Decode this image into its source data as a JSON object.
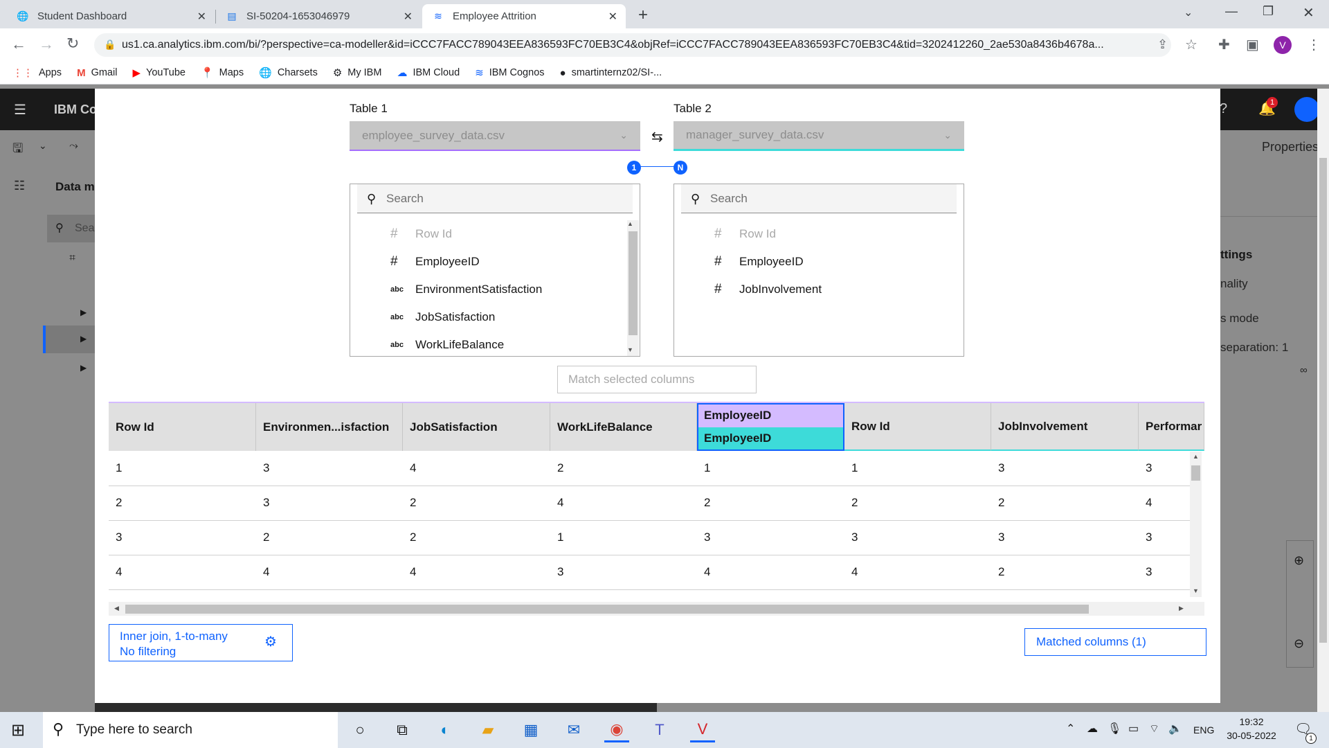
{
  "browser": {
    "tabs": [
      {
        "title": "Student Dashboard"
      },
      {
        "title": "SI-50204-1653046979"
      },
      {
        "title": "Employee Attrition"
      }
    ],
    "url": "us1.ca.analytics.ibm.com/bi/?perspective=ca-modeller&id=iCCC7FACC789043EEA836593FC70EB3C4&objRef=iCCC7FACC789043EEA836593FC70EB3C4&tid=3202412260_2ae530a8436b4678a...",
    "profile_initial": "V",
    "bookmarks": [
      "Apps",
      "Gmail",
      "YouTube",
      "Maps",
      "Charsets",
      "My IBM",
      "IBM Cloud",
      "IBM Cognos",
      "smartinternz02/SI-..."
    ]
  },
  "app": {
    "brand": "IBM Co",
    "notif_count": "1",
    "left_labels": {
      "data_module": "Data m",
      "search": "Sea"
    },
    "right_labels": {
      "properties": "Properties",
      "settings": "ttings",
      "nality": "nality",
      "mode": "s mode",
      "separation": "separation: 1",
      "infinity": "∞"
    }
  },
  "join": {
    "table1_label": "Table 1",
    "table2_label": "Table 2",
    "table1_value": "employee_survey_data.csv",
    "table2_value": "manager_survey_data.csv",
    "card_left": "1",
    "card_right": "N",
    "search_placeholder": "Search",
    "table1_fields": [
      {
        "name": "Row Id",
        "type": "#"
      },
      {
        "name": "EmployeeID",
        "type": "#"
      },
      {
        "name": "EnvironmentSatisfaction",
        "type": "abc"
      },
      {
        "name": "JobSatisfaction",
        "type": "abc"
      },
      {
        "name": "WorkLifeBalance",
        "type": "abc"
      }
    ],
    "table2_fields": [
      {
        "name": "Row Id",
        "type": "#"
      },
      {
        "name": "EmployeeID",
        "type": "#"
      },
      {
        "name": "JobInvolvement",
        "type": "#"
      }
    ],
    "match_button": "Match selected columns",
    "join_type_line1": "Inner join, 1-to-many",
    "join_type_line2": "No filtering",
    "matched_button": "Matched columns (1)"
  },
  "preview": {
    "headers": [
      "Row Id",
      "Environmen...isfaction",
      "JobSatisfaction",
      "WorkLifeBalance",
      "EmployeeID",
      "Row Id",
      "JobInvolvement",
      "Performar"
    ],
    "matched_header_bottom": "EmployeeID",
    "rows": [
      [
        "1",
        "3",
        "4",
        "2",
        "1",
        "1",
        "3",
        "3"
      ],
      [
        "2",
        "3",
        "2",
        "4",
        "2",
        "2",
        "2",
        "4"
      ],
      [
        "3",
        "2",
        "2",
        "1",
        "3",
        "3",
        "3",
        "3"
      ],
      [
        "4",
        "4",
        "4",
        "3",
        "4",
        "4",
        "2",
        "3"
      ]
    ]
  },
  "taskbar": {
    "search_placeholder": "Type here to search",
    "lang": "ENG",
    "time": "19:32",
    "date": "30-05-2022",
    "notif": "1"
  }
}
